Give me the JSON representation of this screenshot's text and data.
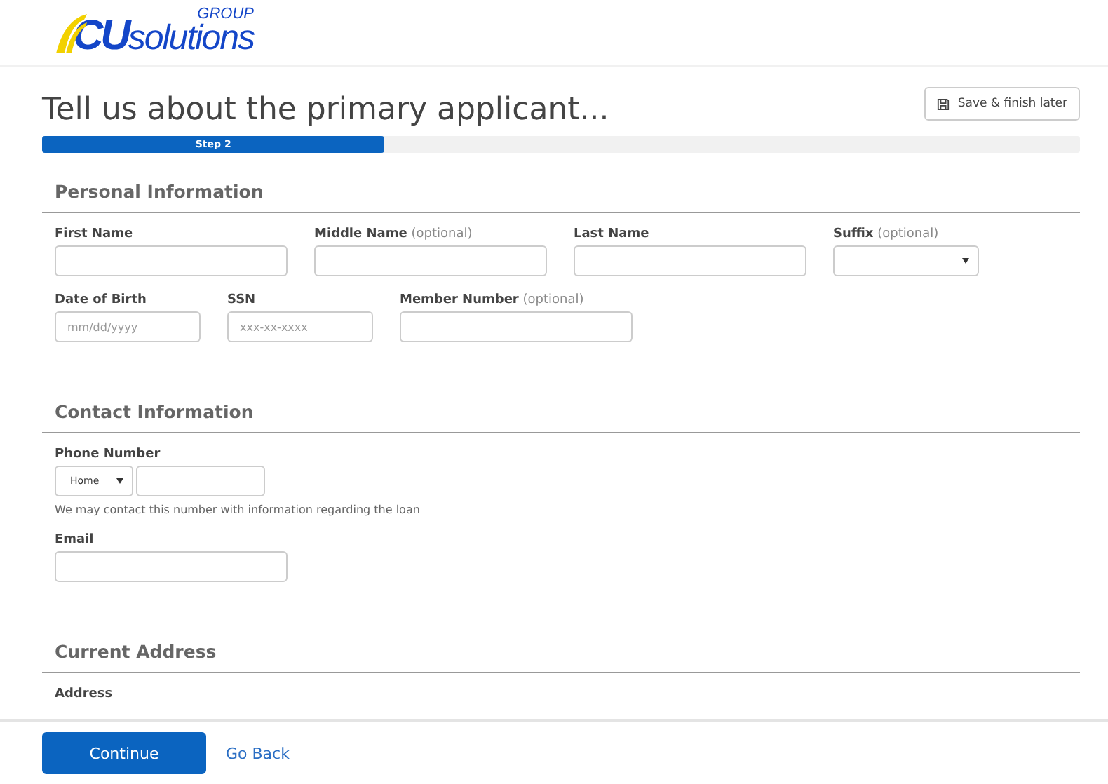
{
  "logo": {
    "mark": "CU",
    "word": "solutions",
    "group": "GROUP"
  },
  "page_title": "Tell us about the primary applicant...",
  "save_button": "Save & finish later",
  "progress": {
    "label": "Step 2",
    "level": 0.33
  },
  "sections": [
    {
      "title": "Personal Information",
      "rows": [
        [
          {
            "kind": "text",
            "label": "First Name"
          },
          {
            "kind": "text",
            "label": "Middle Name",
            "optional": "(optional)"
          },
          {
            "kind": "text",
            "label": "Last Name"
          },
          {
            "kind": "select",
            "label": "Suffix",
            "optional": "(optional)"
          }
        ],
        [
          {
            "kind": "short",
            "label": "Date of Birth",
            "placeholder": "mm/dd/yyyy"
          },
          {
            "kind": "short",
            "label": "SSN",
            "placeholder": "xxx-xx-xxxx"
          },
          {
            "kind": "text",
            "label": "Member Number",
            "optional": "(optional)"
          }
        ]
      ]
    },
    {
      "title": "Contact Information",
      "rows": [
        [
          {
            "kind": "phone",
            "label": "Phone Number",
            "value": "Home",
            "help": "We may contact this number with information regarding the loan"
          }
        ],
        [
          {
            "kind": "text",
            "label": "Email"
          }
        ]
      ]
    },
    {
      "title": "Current Address",
      "rows": [
        [
          {
            "kind": "label",
            "label": "Address"
          }
        ]
      ]
    }
  ],
  "footer": {
    "primary": "Continue",
    "link": "Go Back"
  }
}
